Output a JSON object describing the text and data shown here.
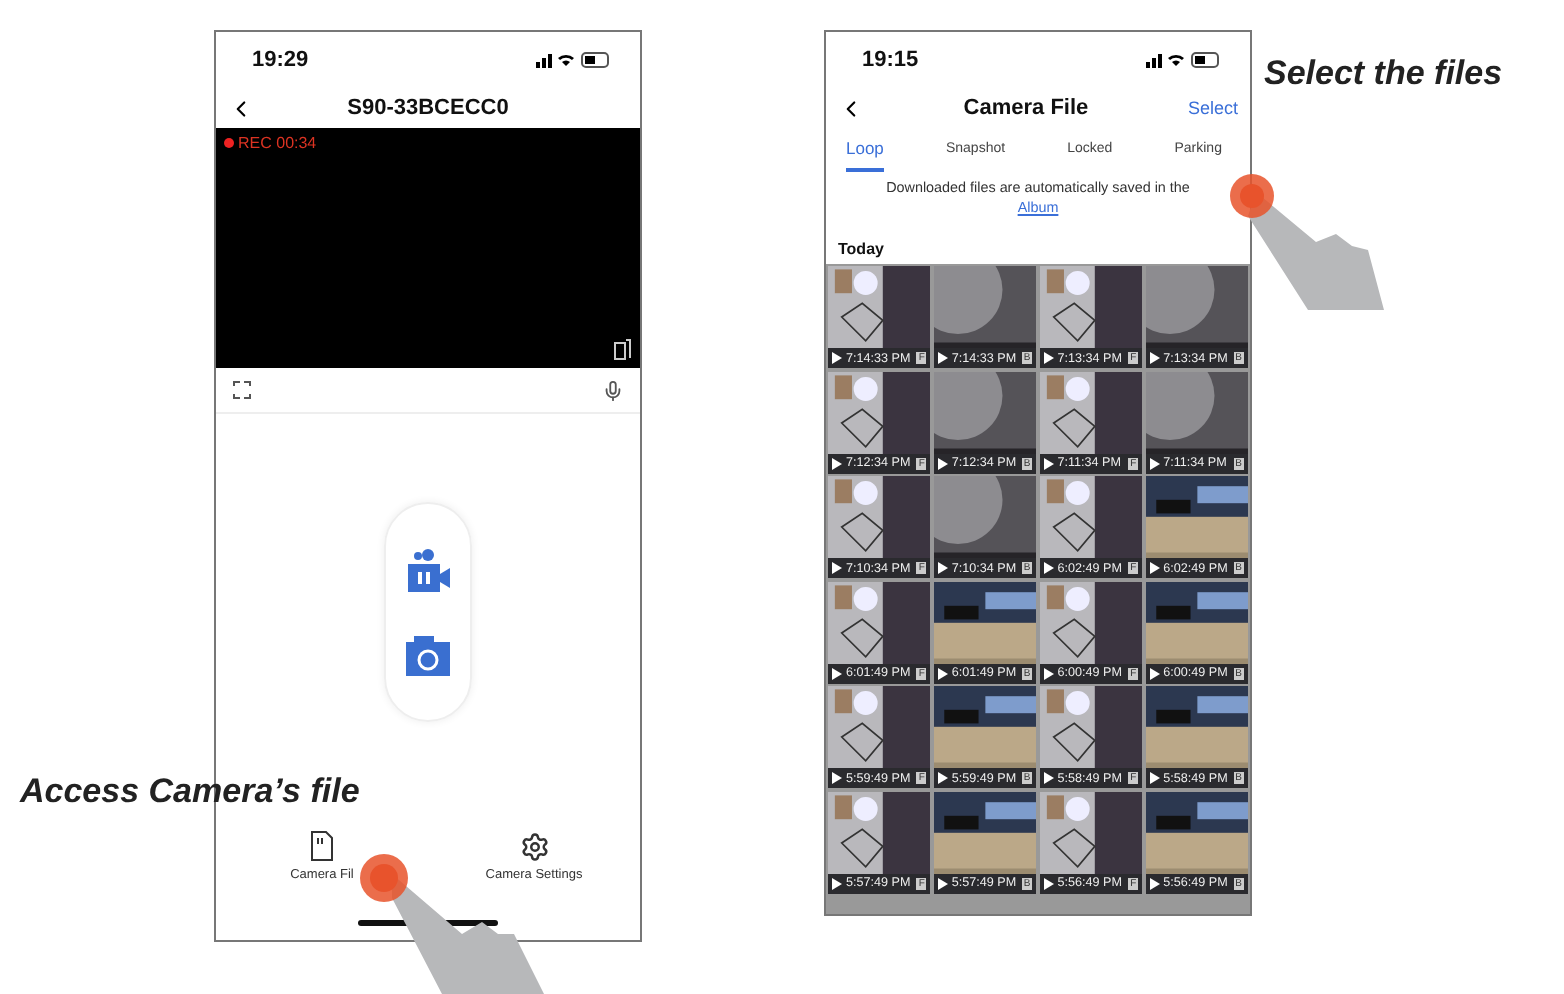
{
  "annotations": [
    {
      "text": "Access Camera’s file",
      "kind": "left"
    },
    {
      "text": "Select the files",
      "kind": "right"
    }
  ],
  "live_screen": {
    "time": "19:29",
    "title": "S90-33BCECC0",
    "rec": "REC 00:34",
    "recording": true,
    "nav": [
      {
        "label": "Camera Fil",
        "kind": "files"
      },
      {
        "label": "Camera Settings",
        "kind": "settings"
      }
    ]
  },
  "files_screen": {
    "time": "19:15",
    "title": "Camera File",
    "action": "Select",
    "tabs": [
      {
        "label": "Loop",
        "selected": true
      },
      {
        "label": "Snapshot",
        "selected": false
      },
      {
        "label": "Locked",
        "selected": false
      },
      {
        "label": "Parking",
        "selected": false
      }
    ],
    "note": {
      "text": "Downloaded files are automatically saved in the",
      "link": "Album"
    },
    "section": "Today",
    "thumbnails": [
      {
        "time": "7:14:33 PM",
        "badge": "F"
      },
      {
        "time": "7:14:33 PM",
        "badge": "B"
      },
      {
        "time": "7:13:34 PM",
        "badge": "F"
      },
      {
        "time": "7:13:34 PM",
        "badge": "B"
      },
      {
        "time": "7:12:34 PM",
        "badge": "F"
      },
      {
        "time": "7:12:34 PM",
        "badge": "B"
      },
      {
        "time": "7:11:34 PM",
        "badge": "F"
      },
      {
        "time": "7:11:34 PM",
        "badge": "B"
      },
      {
        "time": "7:10:34 PM",
        "badge": "F"
      },
      {
        "time": "7:10:34 PM",
        "badge": "B"
      },
      {
        "time": "6:02:49 PM",
        "badge": "F"
      },
      {
        "time": "6:02:49 PM",
        "badge": "B"
      },
      {
        "time": "6:01:49 PM",
        "badge": "F"
      },
      {
        "time": "6:01:49 PM",
        "badge": "B"
      },
      {
        "time": "6:00:49 PM",
        "badge": "F"
      },
      {
        "time": "6:00:49 PM",
        "badge": "B"
      },
      {
        "time": "5:59:49 PM",
        "badge": "F"
      },
      {
        "time": "5:59:49 PM",
        "badge": "B"
      },
      {
        "time": "5:58:49 PM",
        "badge": "F"
      },
      {
        "time": "5:58:49 PM",
        "badge": "B"
      },
      {
        "time": "5:57:49 PM",
        "badge": "F"
      },
      {
        "time": "5:57:49 PM",
        "badge": "B"
      },
      {
        "time": "5:56:49 PM",
        "badge": "F"
      },
      {
        "time": "5:56:49 PM",
        "badge": "B"
      }
    ]
  }
}
